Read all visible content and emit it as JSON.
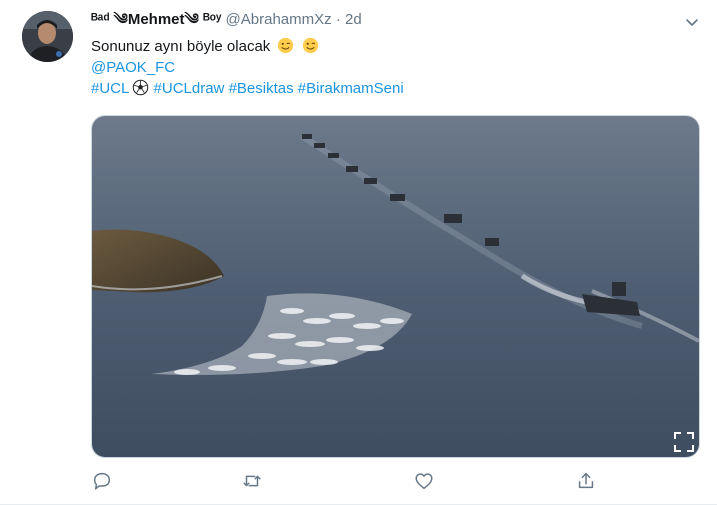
{
  "tweet": {
    "display_name": "ᴮᵃᵈ ༄Mehmet༄ ᴮᵒʸ",
    "handle": "@AbrahammXz",
    "separator": "·",
    "time": "2d",
    "line1": "Sonunuz aynı böyle olacak",
    "mention": "@PAOK_FC",
    "hashtags": {
      "ucl": "#UCL",
      "ucldraw": "#UCLdraw",
      "besiktas": "#Besiktas",
      "birakmam": "#BirakmamSeni"
    },
    "emojis": [
      "winking-face",
      "winking-face",
      "soccer-ball"
    ]
  },
  "actions": {
    "reply": "reply-icon",
    "retweet": "retweet-icon",
    "like": "heart-icon",
    "share": "share-icon"
  },
  "colors": {
    "link": "#1b95e0",
    "secondary": "#657786",
    "text": "#14171a",
    "sea": "#4a5a6f"
  }
}
